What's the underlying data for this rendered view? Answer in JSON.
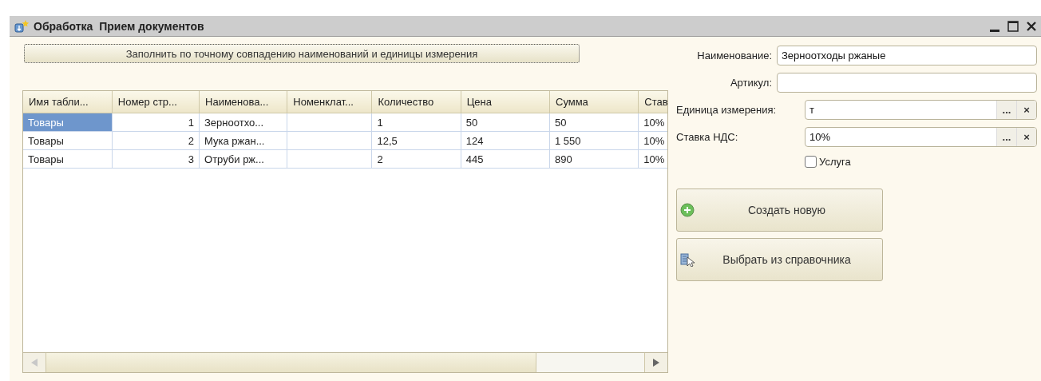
{
  "window": {
    "title": "Обработка  Прием документов"
  },
  "fill_button": {
    "label": "Заполнить по точному совпадению наименований и единицы измерения"
  },
  "table": {
    "columns": [
      "Имя табли...",
      "Номер стр...",
      "Наименова...",
      "Номенклат...",
      "Количество",
      "Цена",
      "Сумма",
      "Став"
    ],
    "rows": [
      {
        "selected": true,
        "cells": [
          "Товары",
          "1",
          "Зерноотхо...",
          "",
          "1",
          "50",
          "50",
          "10%"
        ]
      },
      {
        "selected": false,
        "cells": [
          "Товары",
          "2",
          "Мука ржан...",
          "",
          "12,5",
          "124",
          "1 550",
          "10%"
        ]
      },
      {
        "selected": false,
        "cells": [
          "Товары",
          "3",
          "Отруби рж...",
          "",
          "2",
          "445",
          "890",
          "10%"
        ]
      }
    ]
  },
  "form": {
    "fields": [
      {
        "kind": "text",
        "label": "Наименование:",
        "value": "Зерноотходы ржаные"
      },
      {
        "kind": "text",
        "label": "Артикул:"
      },
      {
        "kind": "choice",
        "label": "Единица измерения:",
        "value": "т",
        "choose": "...",
        "clear": "×"
      },
      {
        "kind": "choice",
        "label": "Ставка НДС:",
        "value": "10%",
        "choose": "...",
        "clear": "×"
      }
    ],
    "checkbox": {
      "label": "Услуга",
      "checked": false
    },
    "buttons": [
      {
        "kind": "create",
        "label": "Создать новую"
      },
      {
        "kind": "pick",
        "label": "Выбрать из справочника"
      }
    ]
  }
}
